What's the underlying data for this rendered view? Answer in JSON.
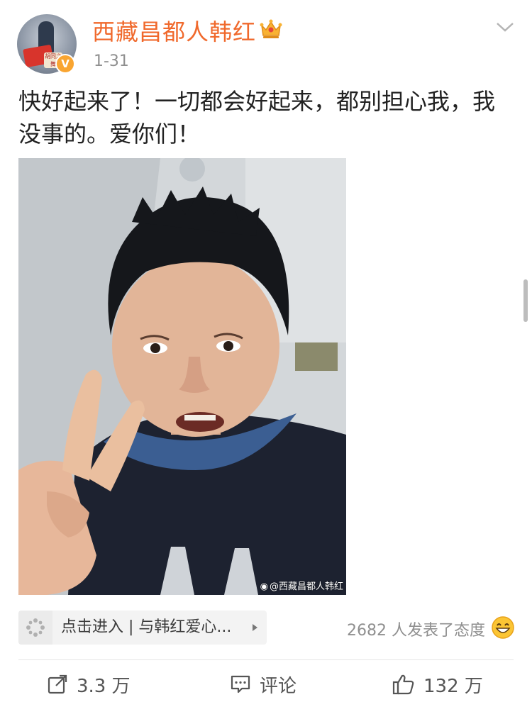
{
  "post": {
    "user_name": "西藏昌都人韩红",
    "time": "1-31",
    "text": "快好起来了！一切都会好起来，都别担心我，我没事的。爱你们！",
    "avatar_stamp": "胡同之舞",
    "photo": {
      "watermark": "@西藏昌都人韩红"
    }
  },
  "topic": {
    "label": "点击进入 | 与韩红爱心..."
  },
  "reactions": {
    "text": "2682 人发表了态度"
  },
  "actions": {
    "repost": "3.3 万",
    "comment": "评论",
    "like": "132 万"
  },
  "colors": {
    "name": "#f0692c",
    "badge": "#f9a531",
    "meta": "#8f8f8f",
    "text": "#222222"
  },
  "icons": {
    "verified": "v-badge-icon",
    "vip": "crown-icon",
    "menu": "chevron-down-icon",
    "topic": "topic-icon",
    "reaction": "smile-icon",
    "repost": "share-icon",
    "comment": "comment-icon",
    "like": "thumbs-up-icon"
  }
}
